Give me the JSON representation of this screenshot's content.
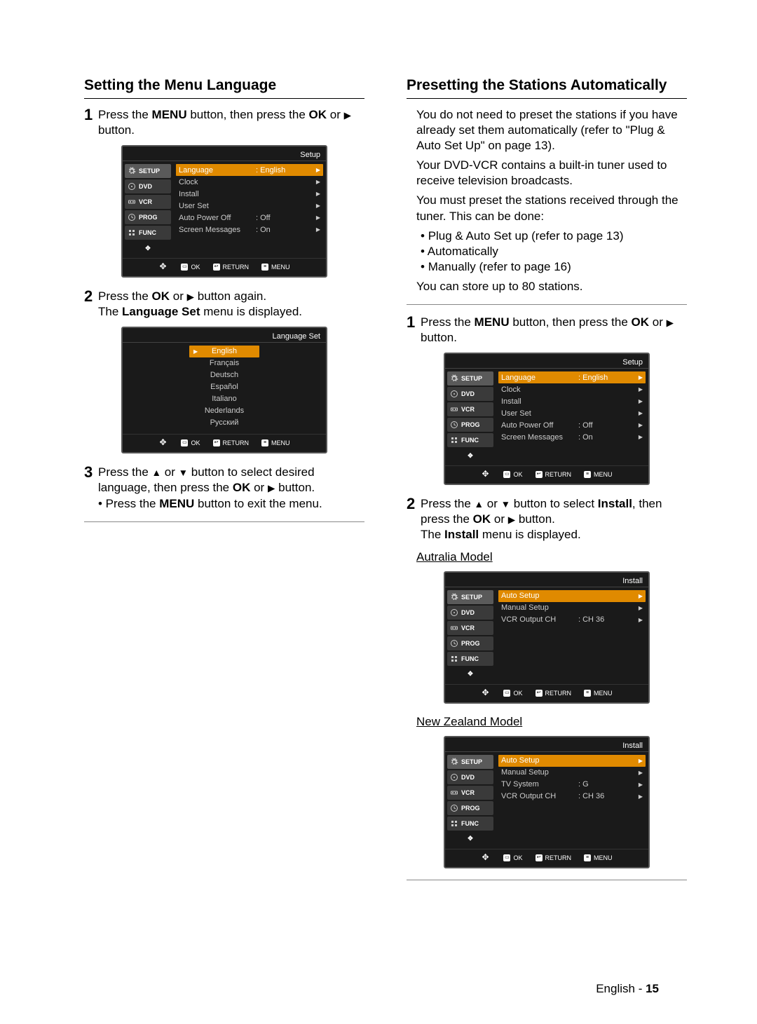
{
  "left": {
    "heading": "Setting the Menu Language",
    "step1": {
      "num": "1",
      "textA": "Press the ",
      "b1": "MENU",
      "textB": " button, then press the ",
      "b2": "OK",
      "textC": " or ",
      "textD": " button."
    },
    "osd1": {
      "title": "Setup",
      "tabs": [
        "SETUP",
        "DVD",
        "VCR",
        "PROG",
        "FUNC"
      ],
      "rows": [
        {
          "label": "Language",
          "val": ": English",
          "sel": true
        },
        {
          "label": "Clock",
          "val": ""
        },
        {
          "label": "Install",
          "val": ""
        },
        {
          "label": "User Set",
          "val": ""
        },
        {
          "label": "Auto Power Off",
          "val": ": Off"
        },
        {
          "label": "Screen Messages",
          "val": ": On"
        }
      ],
      "foot": {
        "ok": "OK",
        "ret": "RETURN",
        "menu": "MENU"
      }
    },
    "step2": {
      "num": "2",
      "textA": "Press the ",
      "b1": "OK",
      "textB": " or ",
      "textC": " button again.",
      "line2a": "The ",
      "b2": "Language Set",
      "line2b": " menu is displayed."
    },
    "osd2": {
      "title": "Language Set",
      "langs": [
        "English",
        "Français",
        "Deutsch",
        "Español",
        "Italiano",
        "Nederlands",
        "Русский"
      ],
      "foot": {
        "ok": "OK",
        "ret": "RETURN",
        "menu": "MENU"
      }
    },
    "step3": {
      "num": "3",
      "textA": "Press the ",
      "textB": " or ",
      "textC": " button to select desired language, then press the ",
      "b1": "OK",
      "textD": " or ",
      "textE": " button.",
      "sub": "• Press the ",
      "subB": "MENU",
      "subC": " button to exit the menu."
    }
  },
  "right": {
    "heading": "Presetting the Stations Automatically",
    "intro": {
      "p1": "You do not need to preset the stations if you have already set them automatically (refer to \"Plug & Auto Set Up\" on page 13).",
      "p2": "Your DVD-VCR contains a built-in tuner used to receive television broadcasts.",
      "p3": "You must preset the stations received through the tuner. This can be done:",
      "b1": "Plug & Auto Set up (refer to page 13)",
      "b2": "Automatically",
      "b3": "Manually (refer to page 16)",
      "p4": "You can store up to 80 stations."
    },
    "step1": {
      "num": "1",
      "textA": "Press the ",
      "b1": "MENU",
      "textB": " button, then press the ",
      "b2": "OK",
      "textC": " or ",
      "textD": " button."
    },
    "osd1": {
      "title": "Setup",
      "tabs": [
        "SETUP",
        "DVD",
        "VCR",
        "PROG",
        "FUNC"
      ],
      "rows": [
        {
          "label": "Language",
          "val": ": English",
          "sel": true
        },
        {
          "label": "Clock",
          "val": ""
        },
        {
          "label": "Install",
          "val": ""
        },
        {
          "label": "User Set",
          "val": ""
        },
        {
          "label": "Auto Power Off",
          "val": ": Off"
        },
        {
          "label": "Screen Messages",
          "val": ": On"
        }
      ],
      "foot": {
        "ok": "OK",
        "ret": "RETURN",
        "menu": "MENU"
      }
    },
    "step2": {
      "num": "2",
      "textA": "Press the ",
      "textB": " or ",
      "textC": " button to select ",
      "b1": "Install",
      "textD": ", then press the ",
      "b2": "OK",
      "textE": " or ",
      "textF": " button.",
      "line2a": "The ",
      "b3": "Install",
      "line2b": " menu is displayed."
    },
    "model1": "Autralia Model",
    "osd2": {
      "title": "Install",
      "tabs": [
        "SETUP",
        "DVD",
        "VCR",
        "PROG",
        "FUNC"
      ],
      "rows": [
        {
          "label": "Auto Setup",
          "val": "",
          "sel": true
        },
        {
          "label": "Manual Setup",
          "val": ""
        },
        {
          "label": "VCR Output CH",
          "val": ": CH 36"
        }
      ],
      "foot": {
        "ok": "OK",
        "ret": "RETURN",
        "menu": "MENU"
      }
    },
    "model2": "New Zealand Model",
    "osd3": {
      "title": "Install",
      "tabs": [
        "SETUP",
        "DVD",
        "VCR",
        "PROG",
        "FUNC"
      ],
      "rows": [
        {
          "label": "Auto Setup",
          "val": "",
          "sel": true
        },
        {
          "label": "Manual Setup",
          "val": ""
        },
        {
          "label": "TV System",
          "val": ": G"
        },
        {
          "label": "VCR Output CH",
          "val": ": CH 36"
        }
      ],
      "foot": {
        "ok": "OK",
        "ret": "RETURN",
        "menu": "MENU"
      }
    }
  },
  "footer": {
    "lang": "English",
    "sep": " - ",
    "page": "15"
  }
}
